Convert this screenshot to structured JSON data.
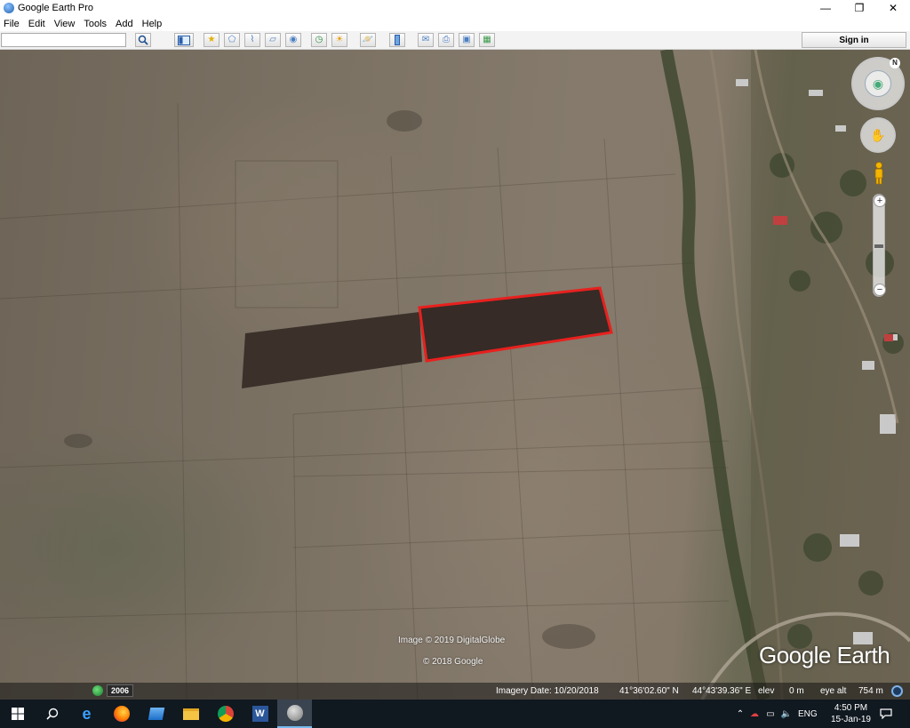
{
  "window": {
    "title": "Google Earth Pro",
    "controls": {
      "minimize": "—",
      "maximize": "❐",
      "close": "✕"
    }
  },
  "menu": [
    "File",
    "Edit",
    "View",
    "Tools",
    "Add",
    "Help"
  ],
  "toolbar": {
    "search_value": "",
    "sign_in_label": "Sign in"
  },
  "map": {
    "attribution_imagery": "Image © 2019 DigitalGlobe",
    "attribution_copyright": "© 2018 Google",
    "logo_text": "Google Earth",
    "compass_label": "N",
    "highlight_color": "#e8201e"
  },
  "statusbar": {
    "history_year": "2006",
    "imagery_date": "Imagery Date: 10/20/2018",
    "latitude": "41°36'02.60\" N",
    "longitude": "44°43'39.36\" E",
    "elev_label": "elev",
    "elev_value": "0 m",
    "eye_alt_label": "eye alt",
    "eye_alt_value": "754 m"
  },
  "taskbar": {
    "language": "ENG",
    "time": "4:50 PM",
    "date": "15-Jan-19"
  }
}
